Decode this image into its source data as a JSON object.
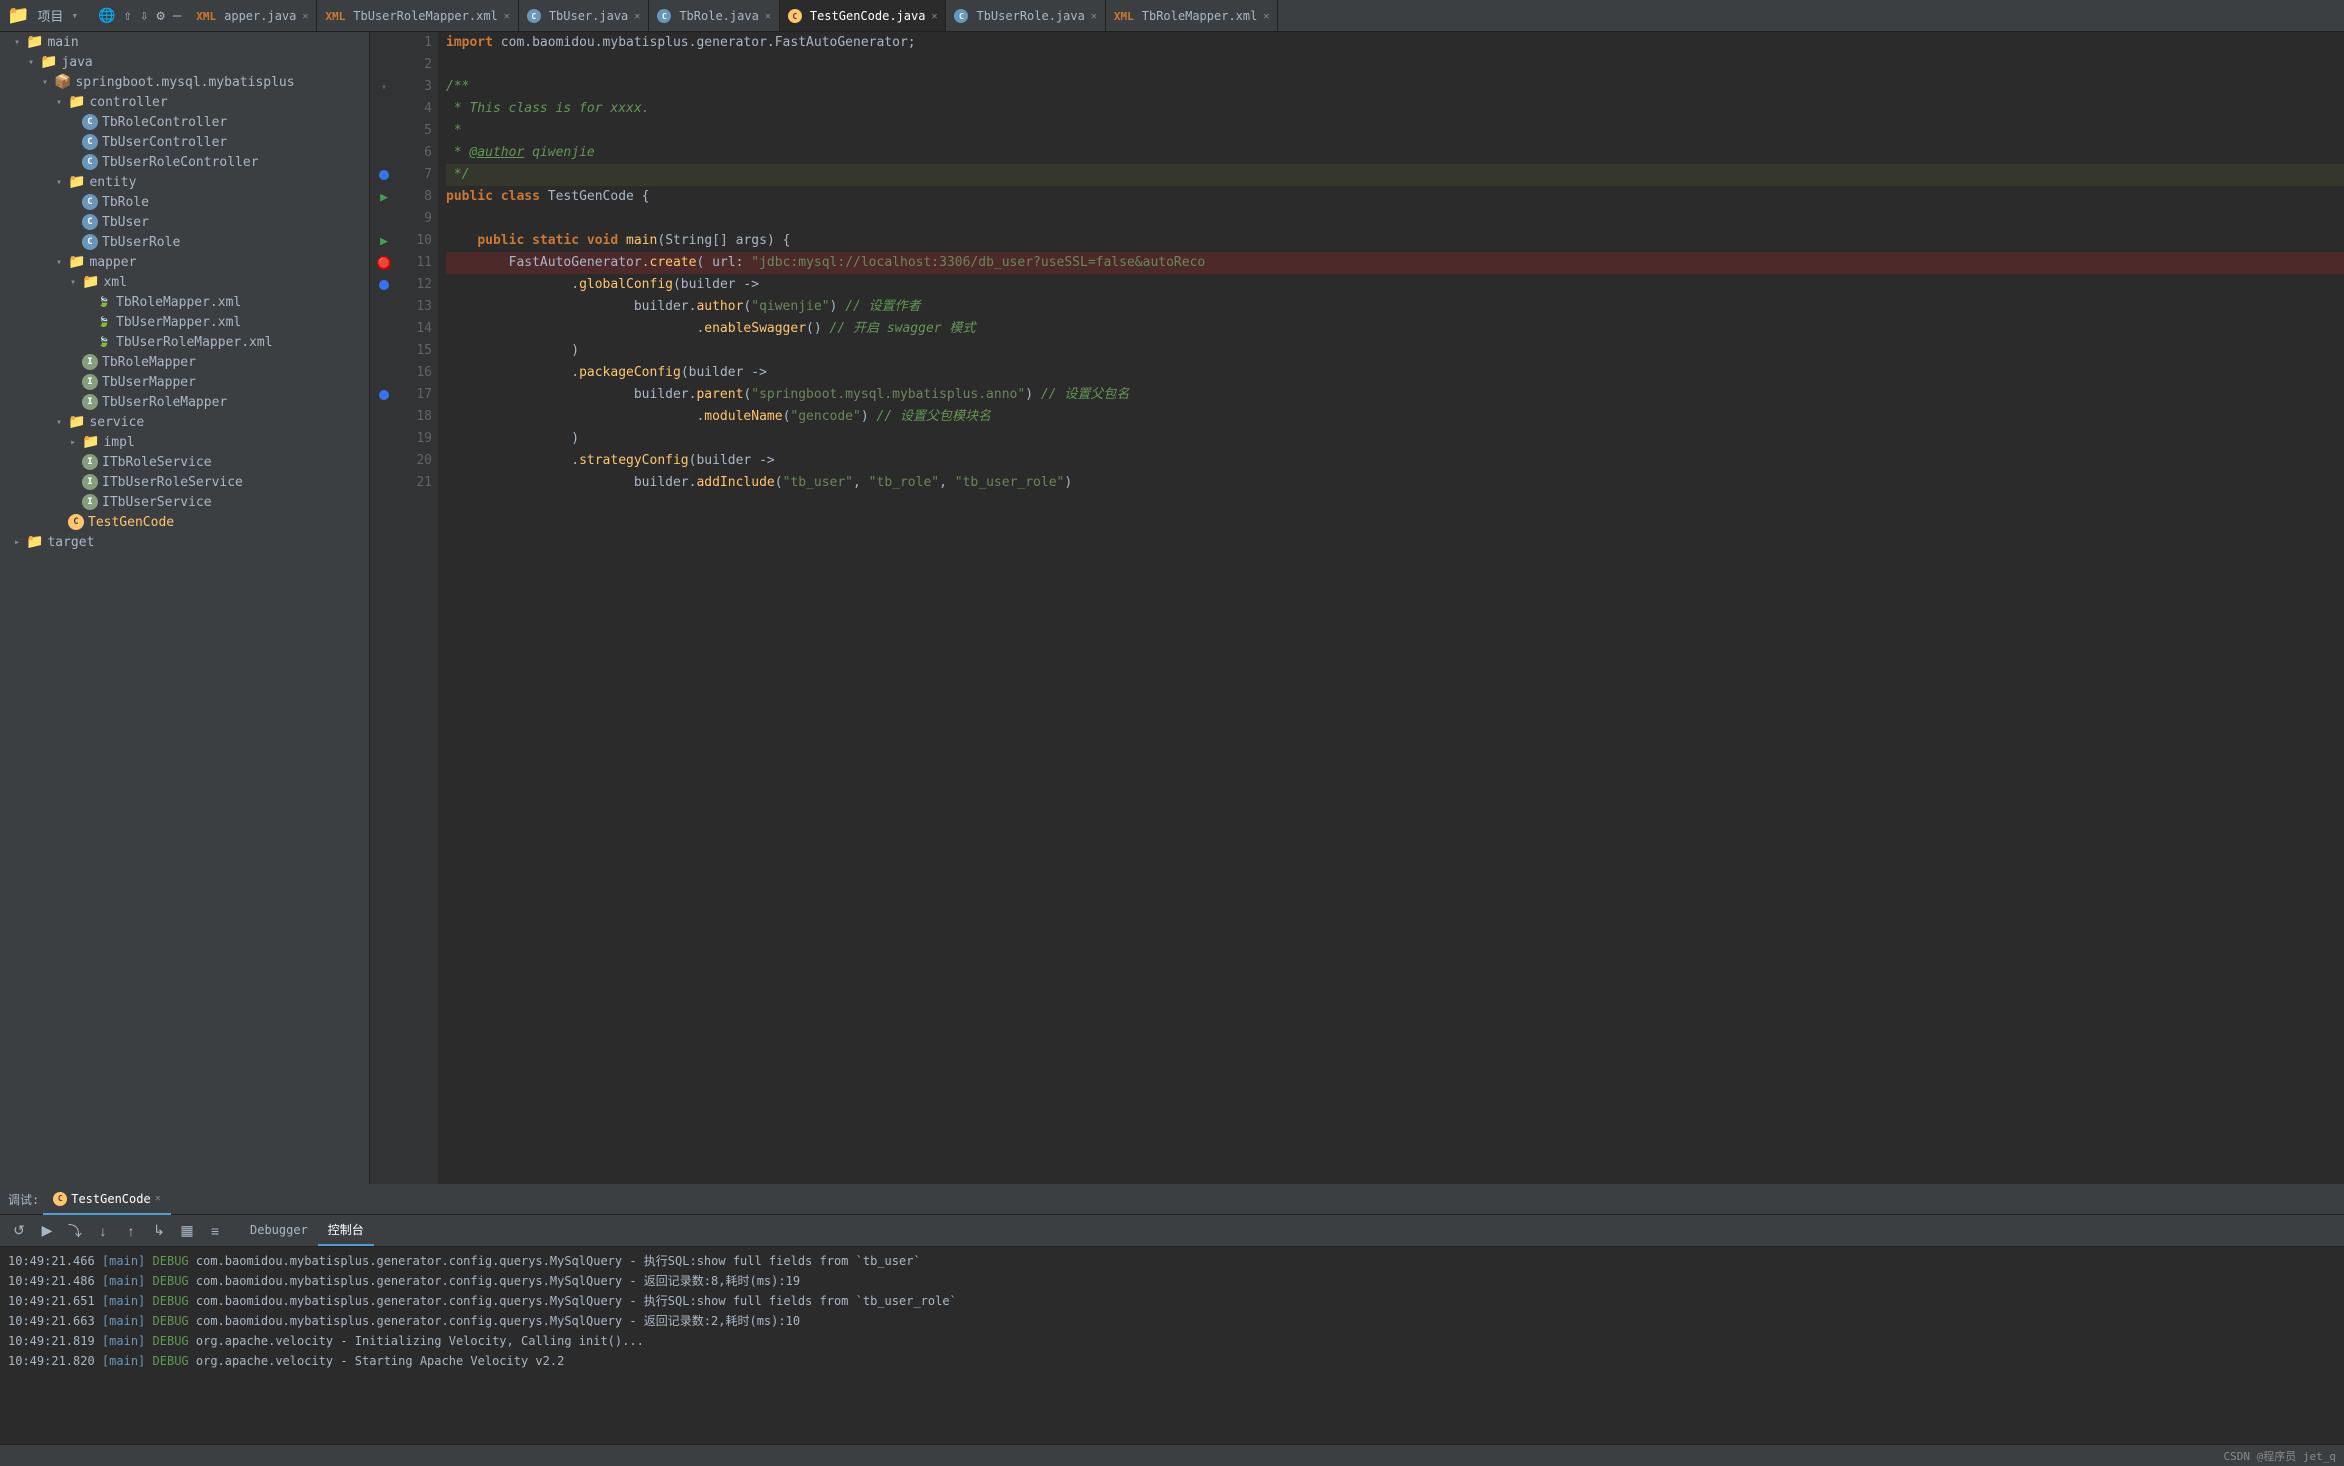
{
  "topbar": {
    "project_label": "项目",
    "icons": [
      "≡",
      "⇧",
      "⇩",
      "⚙",
      "—"
    ]
  },
  "tabs": [
    {
      "id": "mapper-java",
      "icon_type": "xml",
      "label": "apper.java",
      "active": false,
      "closeable": true
    },
    {
      "id": "tb-user-role-mapper-xml",
      "icon_type": "xml",
      "label": "TbUserRoleMapper.xml",
      "active": false,
      "closeable": true
    },
    {
      "id": "tb-user-java",
      "icon_type": "java",
      "label": "TbUser.java",
      "active": false,
      "closeable": true
    },
    {
      "id": "tb-role-java",
      "icon_type": "java",
      "label": "TbRole.java",
      "active": false,
      "closeable": true
    },
    {
      "id": "test-gen-code-java",
      "icon_type": "java_active",
      "label": "TestGenCode.java",
      "active": true,
      "closeable": true
    },
    {
      "id": "tb-user-role-java",
      "icon_type": "java",
      "label": "TbUserRole.java",
      "active": false,
      "closeable": true
    },
    {
      "id": "tb-role-mapper-xml",
      "icon_type": "xml",
      "label": "TbRoleMapper.xml",
      "active": false,
      "closeable": true
    }
  ],
  "sidebar": {
    "root_label": "项目",
    "tree": [
      {
        "id": "main",
        "label": "main",
        "type": "folder",
        "depth": 1,
        "expanded": true
      },
      {
        "id": "java",
        "label": "java",
        "type": "folder",
        "depth": 2,
        "expanded": true
      },
      {
        "id": "springboot",
        "label": "springboot.mysql.mybatisplus",
        "type": "package",
        "depth": 3,
        "expanded": true
      },
      {
        "id": "controller",
        "label": "controller",
        "type": "folder",
        "depth": 4,
        "expanded": true
      },
      {
        "id": "TbRoleController",
        "label": "TbRoleController",
        "type": "java_c",
        "depth": 5
      },
      {
        "id": "TbUserController",
        "label": "TbUserController",
        "type": "java_c",
        "depth": 5
      },
      {
        "id": "TbUserRoleController",
        "label": "TbUserRoleController",
        "type": "java_c",
        "depth": 5
      },
      {
        "id": "entity",
        "label": "entity",
        "type": "folder",
        "depth": 4,
        "expanded": true
      },
      {
        "id": "TbRole",
        "label": "TbRole",
        "type": "java_c",
        "depth": 5
      },
      {
        "id": "TbUser",
        "label": "TbUser",
        "type": "java_c",
        "depth": 5
      },
      {
        "id": "TbUserRole",
        "label": "TbUserRole",
        "type": "java_c",
        "depth": 5
      },
      {
        "id": "mapper",
        "label": "mapper",
        "type": "folder",
        "depth": 4,
        "expanded": true
      },
      {
        "id": "xml",
        "label": "xml",
        "type": "folder",
        "depth": 5,
        "expanded": true
      },
      {
        "id": "TbRoleMapper.xml",
        "label": "TbRoleMapper.xml",
        "type": "xml",
        "depth": 6
      },
      {
        "id": "TbUserMapper.xml",
        "label": "TbUserMapper.xml",
        "type": "xml",
        "depth": 6
      },
      {
        "id": "TbUserRoleMapper.xml",
        "label": "TbUserRoleMapper.xml",
        "type": "xml",
        "depth": 6
      },
      {
        "id": "TbRoleMapper",
        "label": "TbRoleMapper",
        "type": "java_i",
        "depth": 5
      },
      {
        "id": "TbUserMapper",
        "label": "TbUserMapper",
        "type": "java_i",
        "depth": 5
      },
      {
        "id": "TbUserRoleMapper",
        "label": "TbUserRoleMapper",
        "type": "java_i",
        "depth": 5
      },
      {
        "id": "service",
        "label": "service",
        "type": "folder",
        "depth": 4,
        "expanded": true
      },
      {
        "id": "impl",
        "label": "impl",
        "type": "folder",
        "depth": 5,
        "expanded": false
      },
      {
        "id": "ITbRoleService",
        "label": "ITbRoleService",
        "type": "java_i",
        "depth": 5
      },
      {
        "id": "ITbUserRoleService",
        "label": "ITbUserRoleService",
        "type": "java_i",
        "depth": 5
      },
      {
        "id": "ITbUserService",
        "label": "ITbUserService",
        "type": "java_i",
        "depth": 5
      },
      {
        "id": "TestGenCode",
        "label": "TestGenCode",
        "type": "java_active",
        "depth": 4
      },
      {
        "id": "target",
        "label": "target",
        "type": "folder",
        "depth": 1,
        "expanded": false
      }
    ]
  },
  "code": {
    "lines": [
      {
        "num": 1,
        "content": "import com.baomidou.mybatisplus.generator.FastAutoGenerator;",
        "gutter": "",
        "highlight": false
      },
      {
        "num": 2,
        "content": "",
        "gutter": "",
        "highlight": false
      },
      {
        "num": 3,
        "content": "/**",
        "gutter": "fold",
        "highlight": false
      },
      {
        "num": 4,
        "content": " * This class is for xxxx.",
        "gutter": "",
        "highlight": false
      },
      {
        "num": 5,
        "content": " *",
        "gutter": "",
        "highlight": false
      },
      {
        "num": 6,
        "content": " * @author qiwenjie",
        "gutter": "",
        "highlight": false
      },
      {
        "num": 7,
        "content": " */",
        "gutter": "bookmark",
        "highlight": true
      },
      {
        "num": 8,
        "content": "public class TestGenCode {",
        "gutter": "run",
        "highlight": false
      },
      {
        "num": 9,
        "content": "",
        "gutter": "",
        "highlight": false
      },
      {
        "num": 10,
        "content": "    public static void main(String[] args) {",
        "gutter": "run",
        "highlight": false
      },
      {
        "num": 11,
        "content": "        FastAutoGenerator.create( url: \"jdbc:mysql://localhost:3306/db_user?useSSL=false&autoReco",
        "gutter": "error",
        "highlight": true,
        "error": true
      },
      {
        "num": 12,
        "content": "                .globalConfig(builder ->",
        "gutter": "bookmark",
        "highlight": false
      },
      {
        "num": 13,
        "content": "                        builder.author(\"qiwenjie\") // 设置作者",
        "gutter": "",
        "highlight": false
      },
      {
        "num": 14,
        "content": "                                .enableSwagger() // 开启 swagger 模式",
        "gutter": "",
        "highlight": false
      },
      {
        "num": 15,
        "content": "                )",
        "gutter": "",
        "highlight": false
      },
      {
        "num": 16,
        "content": "                .packageConfig(builder ->",
        "gutter": "",
        "highlight": false
      },
      {
        "num": 17,
        "content": "                        builder.parent(\"springboot.mysql.mybatisplus.anno\") // 设置父包名",
        "gutter": "bookmark",
        "highlight": false
      },
      {
        "num": 18,
        "content": "                                .moduleName(\"gencode\") // 设置父包模块名",
        "gutter": "",
        "highlight": false
      },
      {
        "num": 19,
        "content": "                )",
        "gutter": "",
        "highlight": false
      },
      {
        "num": 20,
        "content": "                .strategyConfig(builder ->",
        "gutter": "",
        "highlight": false
      },
      {
        "num": 21,
        "content": "                        builder.addInclude(\"tb_user\", \"tb_role\", \"tb_user_role\")",
        "gutter": "",
        "highlight": false
      }
    ]
  },
  "bottom": {
    "debug_tab": "调试:",
    "test_gen_code_tab": "TestGenCode",
    "tabs": [
      {
        "id": "debugger",
        "label": "Debugger",
        "active": false
      },
      {
        "id": "console",
        "label": "控制台",
        "active": true
      }
    ],
    "console_lines": [
      "10:49:21.466 [main] DEBUG com.baomidou.mybatisplus.generator.config.querys.MySqlQuery - 执行SQL:show full fields from `tb_user`",
      "10:49:21.486 [main] DEBUG com.baomidou.mybatisplus.generator.config.querys.MySqlQuery - 返回记录数:8,耗时(ms):19",
      "10:49:21.651 [main] DEBUG com.baomidou.mybatisplus.generator.config.querys.MySqlQuery - 执行SQL:show full fields from `tb_user_role`",
      "10:49:21.663 [main] DEBUG com.baomidou.mybatisplus.generator.config.querys.MySqlQuery - 返回记录数:2,耗时(ms):10",
      "10:49:21.819 [main] DEBUG org.apache.velocity - Initializing Velocity, Calling init()...",
      "10:49:21.820 [main] DEBUG org.apache.velocity - Starting Apache Velocity v2.2"
    ]
  },
  "status_bar": {
    "right_text": "CSDN @程序员 jet_q"
  }
}
